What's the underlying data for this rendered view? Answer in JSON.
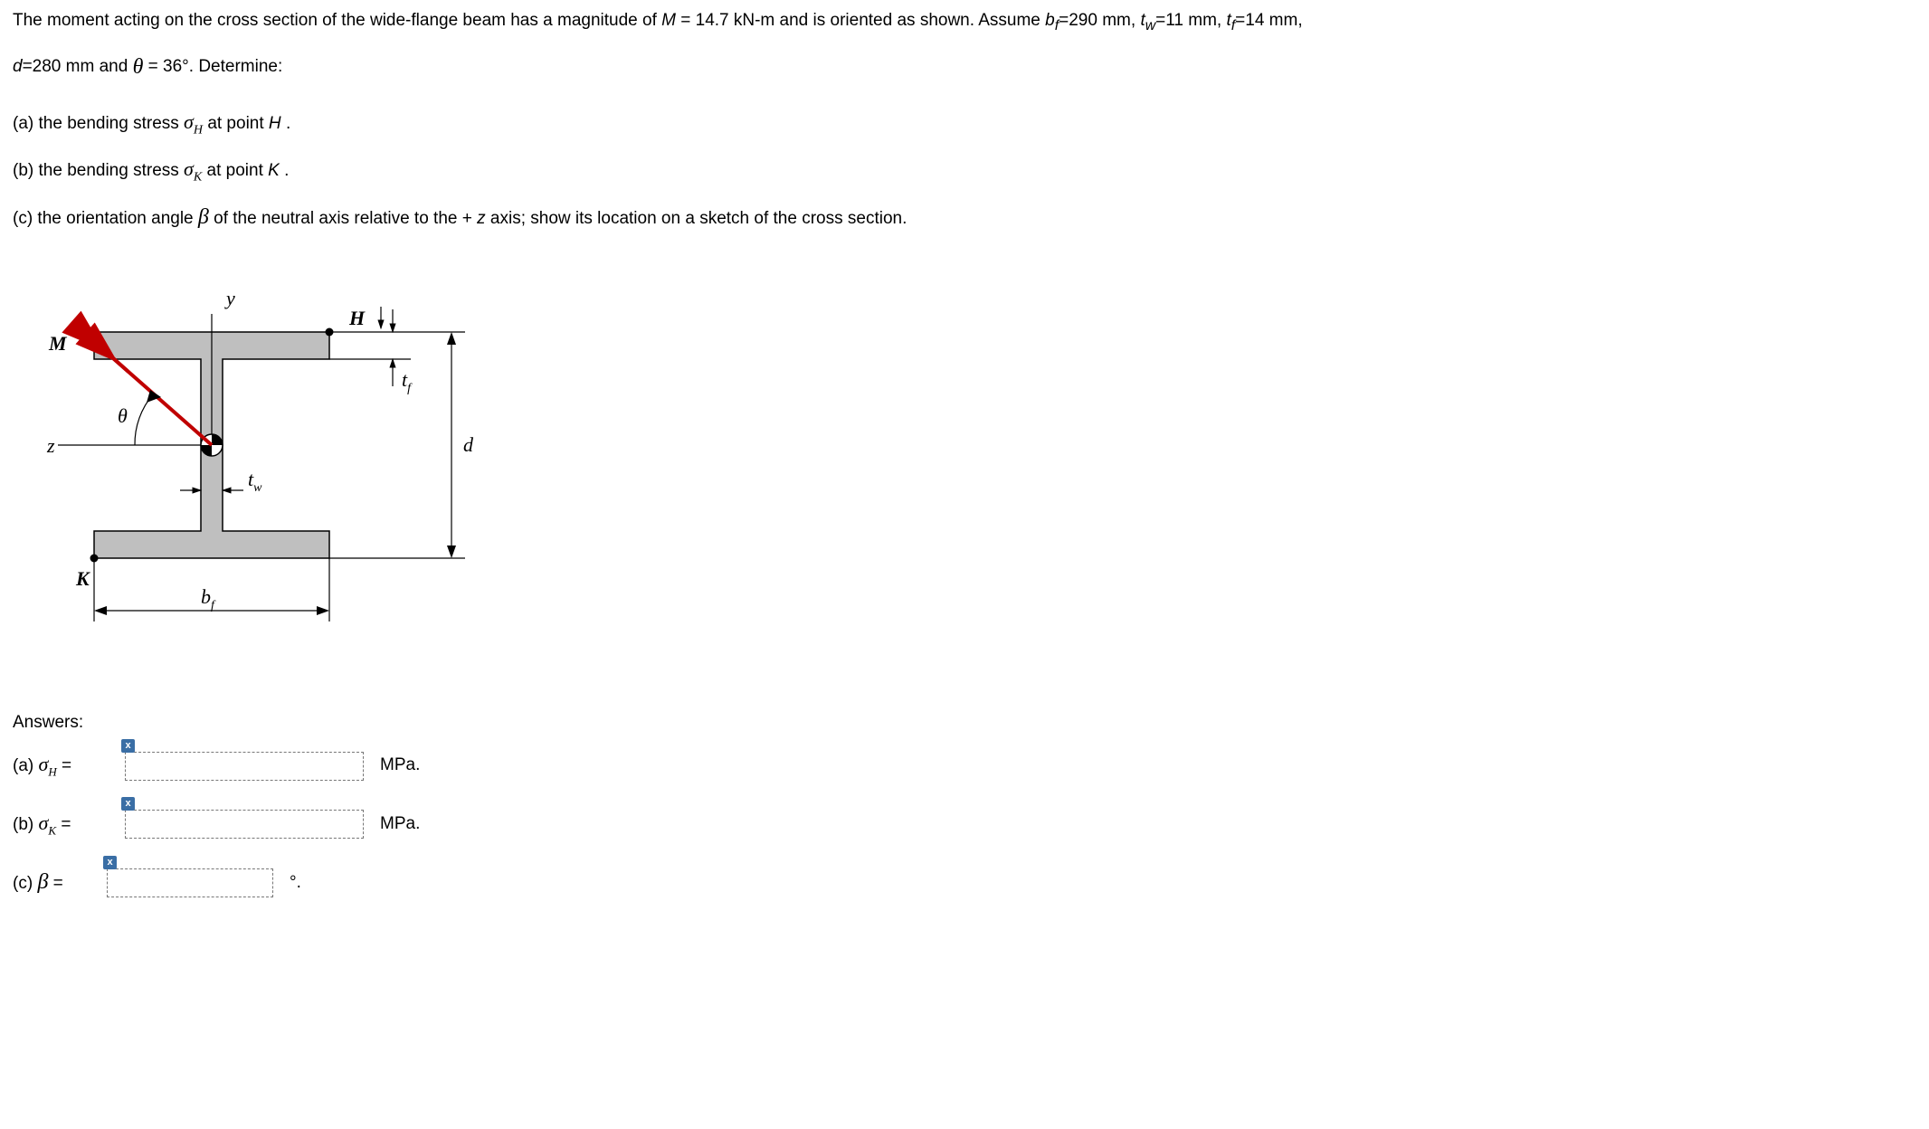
{
  "problem": {
    "intro_part1": "The moment acting on the cross section of the wide-flange beam has a magnitude of ",
    "M_expr": "M = 14.7 kN-m",
    "intro_part2": " and is oriented as shown. Assume ",
    "bf": "b",
    "bf_sub": "f",
    "bf_val": "=290 mm, ",
    "tw": "t",
    "tw_sub": "w",
    "tw_val": "=11 mm, ",
    "tf": "t",
    "tf_sub": "f",
    "tf_val": "=14 mm,",
    "line2_d": "d",
    "line2_dval": "=280 mm and  ",
    "theta_eq": " =   36°. Determine:",
    "part_a_1": "(a) the bending stress  ",
    "part_a_2": "  at point ",
    "part_a_3": "H",
    "part_a_4": ".",
    "part_b_1": "(b) the bending stress  ",
    "part_b_2": "  at point ",
    "part_b_3": "K",
    "part_b_4": ".",
    "part_c_1": "(c) the orientation angle  ",
    "part_c_2": "  of the neutral axis relative to the +",
    "part_c_3": "z",
    "part_c_4": " axis; show its location on a sketch of the cross section."
  },
  "symbols": {
    "sigmaH_pre": "σ",
    "sigmaH_sub": "H",
    "sigmaK_pre": "σ",
    "sigmaK_sub": "K",
    "theta": "θ",
    "beta": "β"
  },
  "diagram": {
    "y": "y",
    "z": "z",
    "M": "M",
    "H": "H",
    "K": "K",
    "d": "d",
    "theta": "θ",
    "tw": "t",
    "tw_sub": "w",
    "tf": "t",
    "tf_sub": "f",
    "bf": "b",
    "bf_sub": "f"
  },
  "answers": {
    "heading": "Answers:",
    "a_label_pre": "(a)  ",
    "a_sigma": "σ",
    "a_sub": "H",
    "a_eq": " = ",
    "a_unit": "MPa.",
    "b_label_pre": "(b)  ",
    "b_sigma": "σ",
    "b_sub": "K",
    "b_eq": " = ",
    "b_unit": "MPa.",
    "c_label_pre": "(c)  ",
    "c_beta": "β",
    "c_eq": " = ",
    "c_unit": "°.",
    "x": "x"
  }
}
